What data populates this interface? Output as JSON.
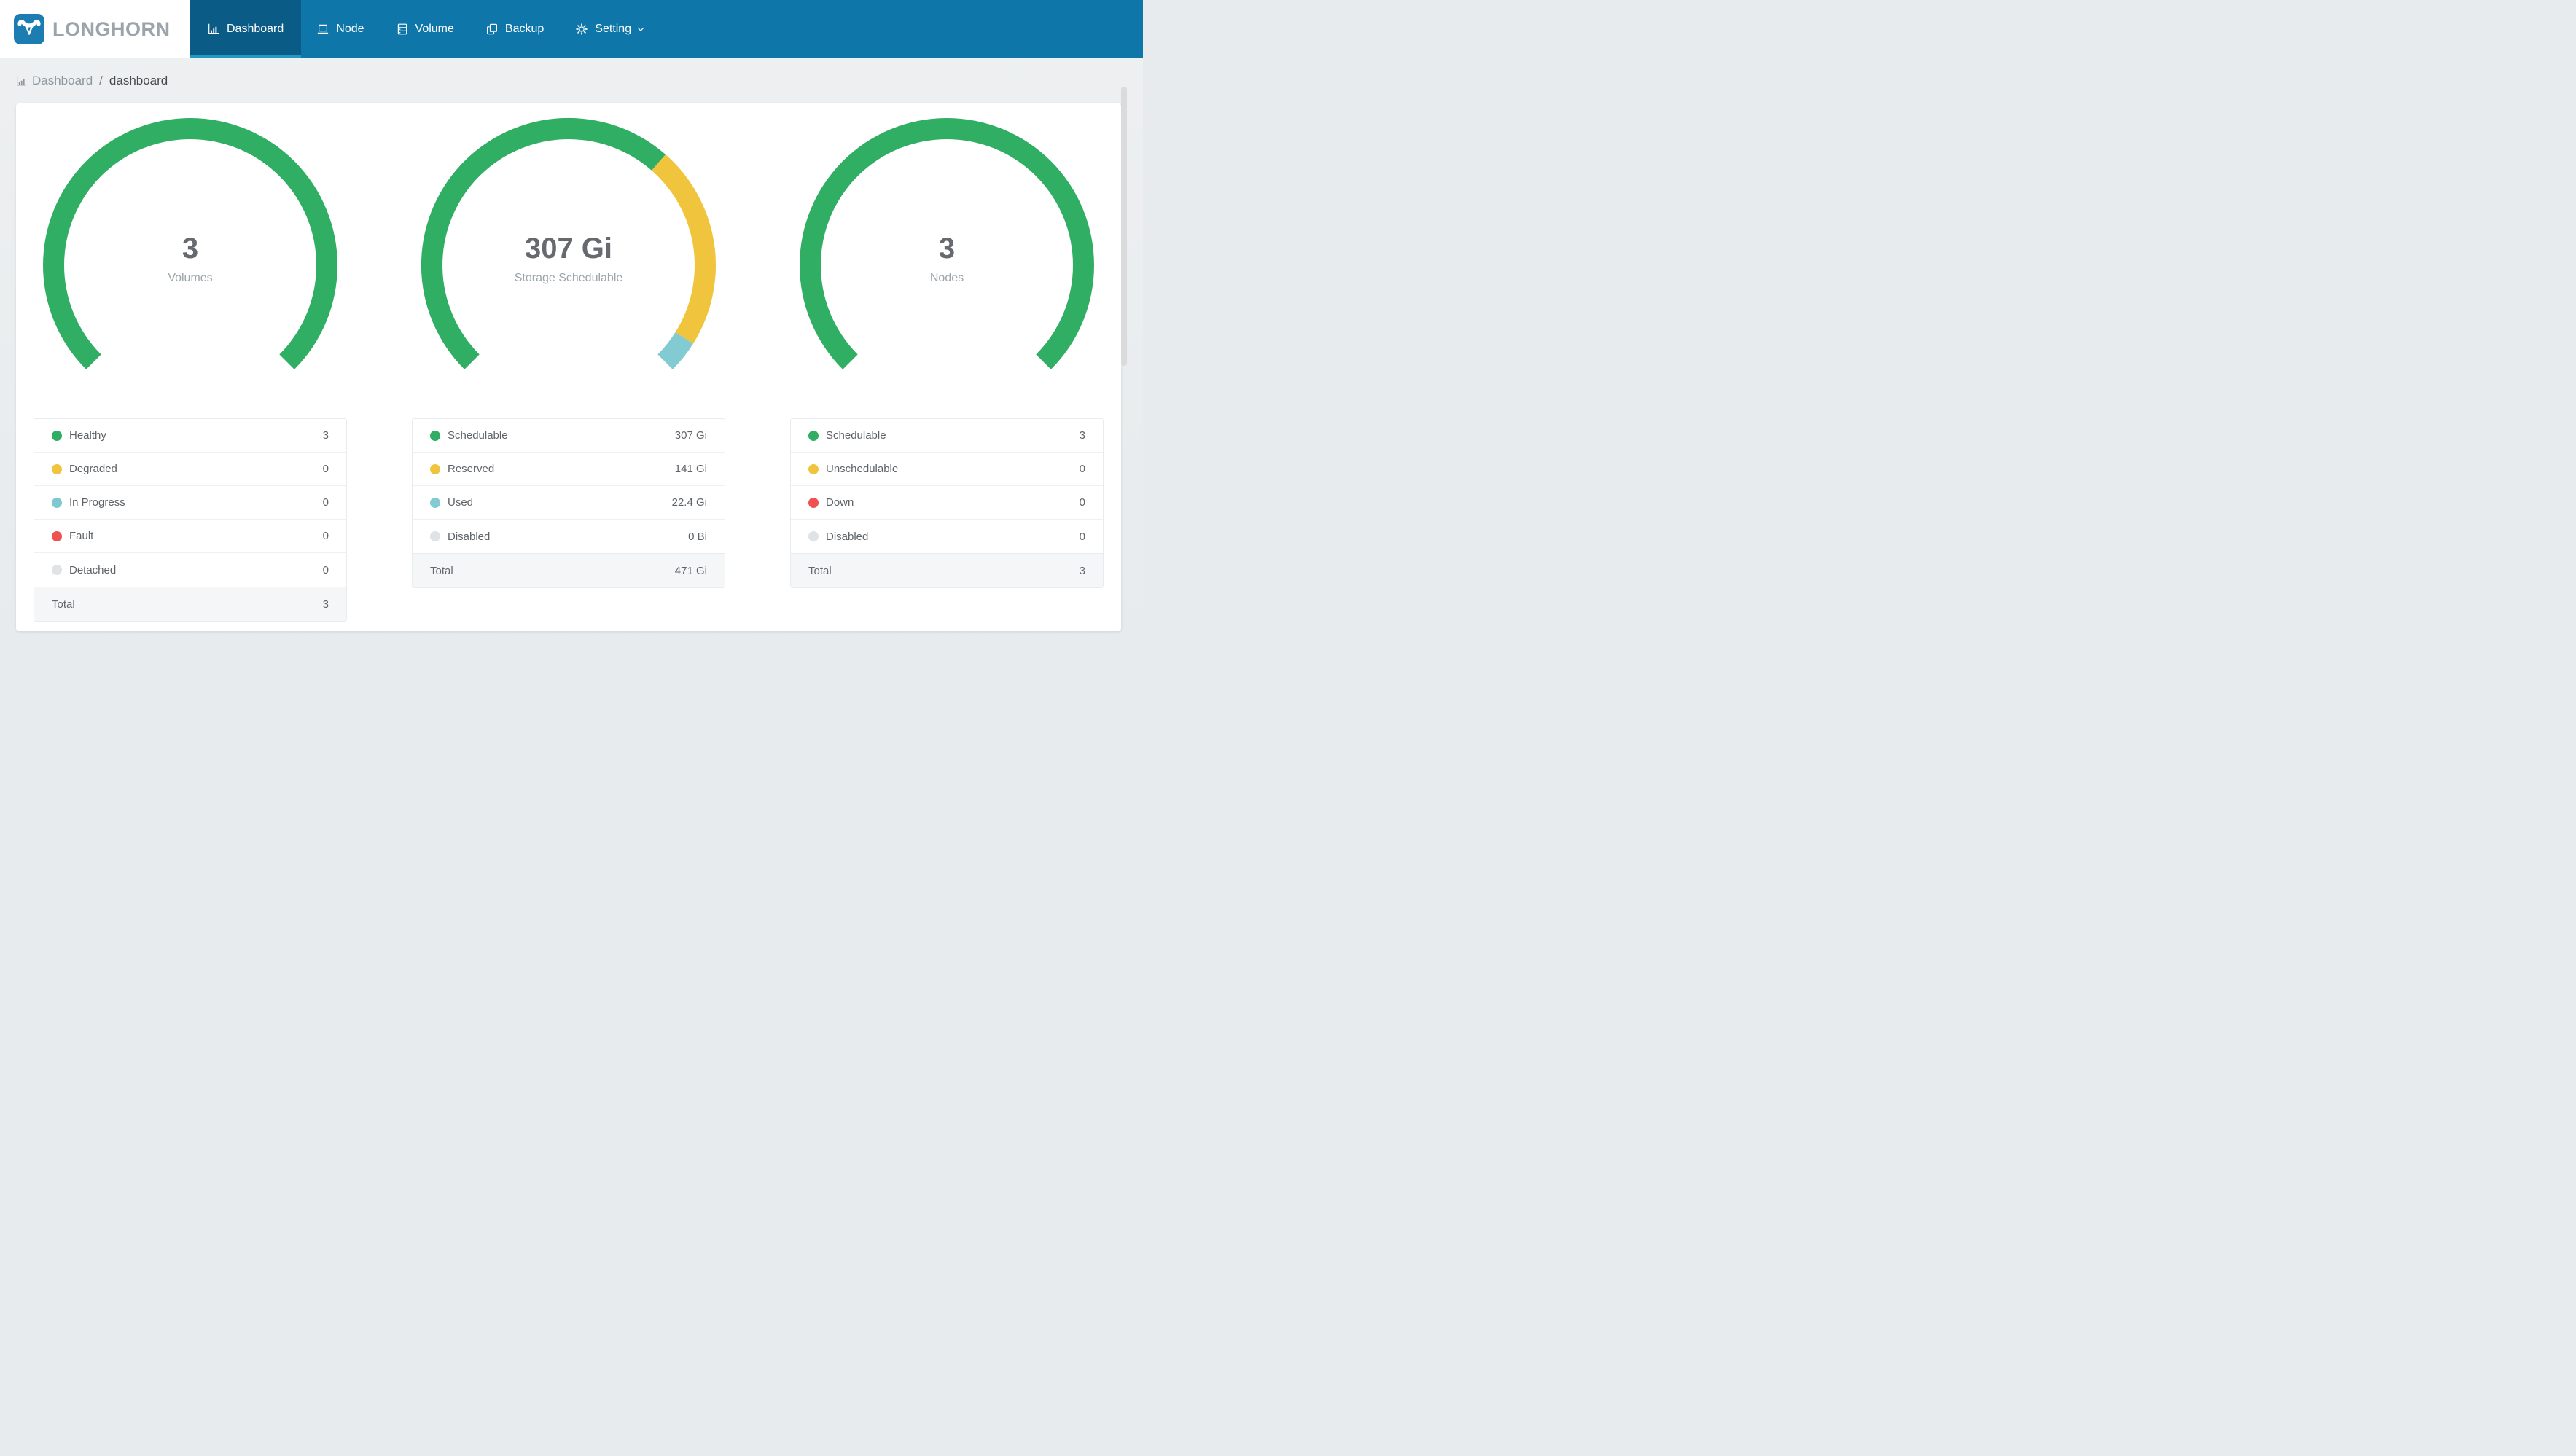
{
  "navbar": {
    "brand": "LONGHORN",
    "logo_icon": "longhorn-bull-icon",
    "colors": {
      "background": "#0e76a8",
      "active_background": "#0b5b87",
      "active_underline": "#2598c1",
      "logo_blue": "#1b7db2"
    },
    "items": [
      {
        "label": "Dashboard",
        "icon": "bar-chart-icon",
        "active": true,
        "has_dropdown": false
      },
      {
        "label": "Node",
        "icon": "laptop-icon",
        "active": false,
        "has_dropdown": false
      },
      {
        "label": "Volume",
        "icon": "storage-stack-icon",
        "active": false,
        "has_dropdown": false
      },
      {
        "label": "Backup",
        "icon": "copy-icon",
        "active": false,
        "has_dropdown": false
      },
      {
        "label": "Setting",
        "icon": "gear-icon",
        "active": false,
        "has_dropdown": true,
        "dropdown_icon": "chevron-down-icon"
      }
    ]
  },
  "breadcrumb": {
    "icon": "bar-chart-icon",
    "separator": "/",
    "crumbs": [
      {
        "label": "Dashboard"
      },
      {
        "label": "dashboard"
      }
    ]
  },
  "chart_data": [
    {
      "type": "gauge",
      "center_value": "3",
      "center_label": "Volumes",
      "start_angle": 225,
      "end_angle": -45,
      "segments": [
        {
          "label": "Healthy",
          "value": 3,
          "display_value": "3",
          "color": "#2fae64"
        },
        {
          "label": "Degraded",
          "value": 0,
          "display_value": "0",
          "color": "#f0c53d"
        },
        {
          "label": "In Progress",
          "value": 0,
          "display_value": "0",
          "color": "#7cc9d1"
        },
        {
          "label": "Fault",
          "value": 0,
          "display_value": "0",
          "color": "#ee5352"
        },
        {
          "label": "Detached",
          "value": 0,
          "display_value": "0",
          "color": "#e0e3e5"
        }
      ],
      "total": {
        "label": "Total",
        "value": 3,
        "display_value": "3"
      }
    },
    {
      "type": "gauge",
      "center_value": "307 Gi",
      "center_label": "Storage Schedulable",
      "start_angle": 225,
      "end_angle": -45,
      "segments": [
        {
          "label": "Schedulable",
          "value": 307,
          "display_value": "307 Gi",
          "color": "#2fae64"
        },
        {
          "label": "Reserved",
          "value": 141,
          "display_value": "141 Gi",
          "color": "#f0c53d"
        },
        {
          "label": "Used",
          "value": 22.4,
          "display_value": "22.4 Gi",
          "color": "#82cbd2"
        },
        {
          "label": "Disabled",
          "value": 0,
          "display_value": "0 Bi",
          "color": "#e0e3e5"
        }
      ],
      "total": {
        "label": "Total",
        "value": 471,
        "display_value": "471 Gi"
      }
    },
    {
      "type": "gauge",
      "center_value": "3",
      "center_label": "Nodes",
      "start_angle": 225,
      "end_angle": -45,
      "segments": [
        {
          "label": "Schedulable",
          "value": 3,
          "display_value": "3",
          "color": "#2fae64"
        },
        {
          "label": "Unschedulable",
          "value": 0,
          "display_value": "0",
          "color": "#f0c53d"
        },
        {
          "label": "Down",
          "value": 0,
          "display_value": "0",
          "color": "#ee5352"
        },
        {
          "label": "Disabled",
          "value": 0,
          "display_value": "0",
          "color": "#e0e3e5"
        }
      ],
      "total": {
        "label": "Total",
        "value": 3,
        "display_value": "3"
      }
    }
  ]
}
